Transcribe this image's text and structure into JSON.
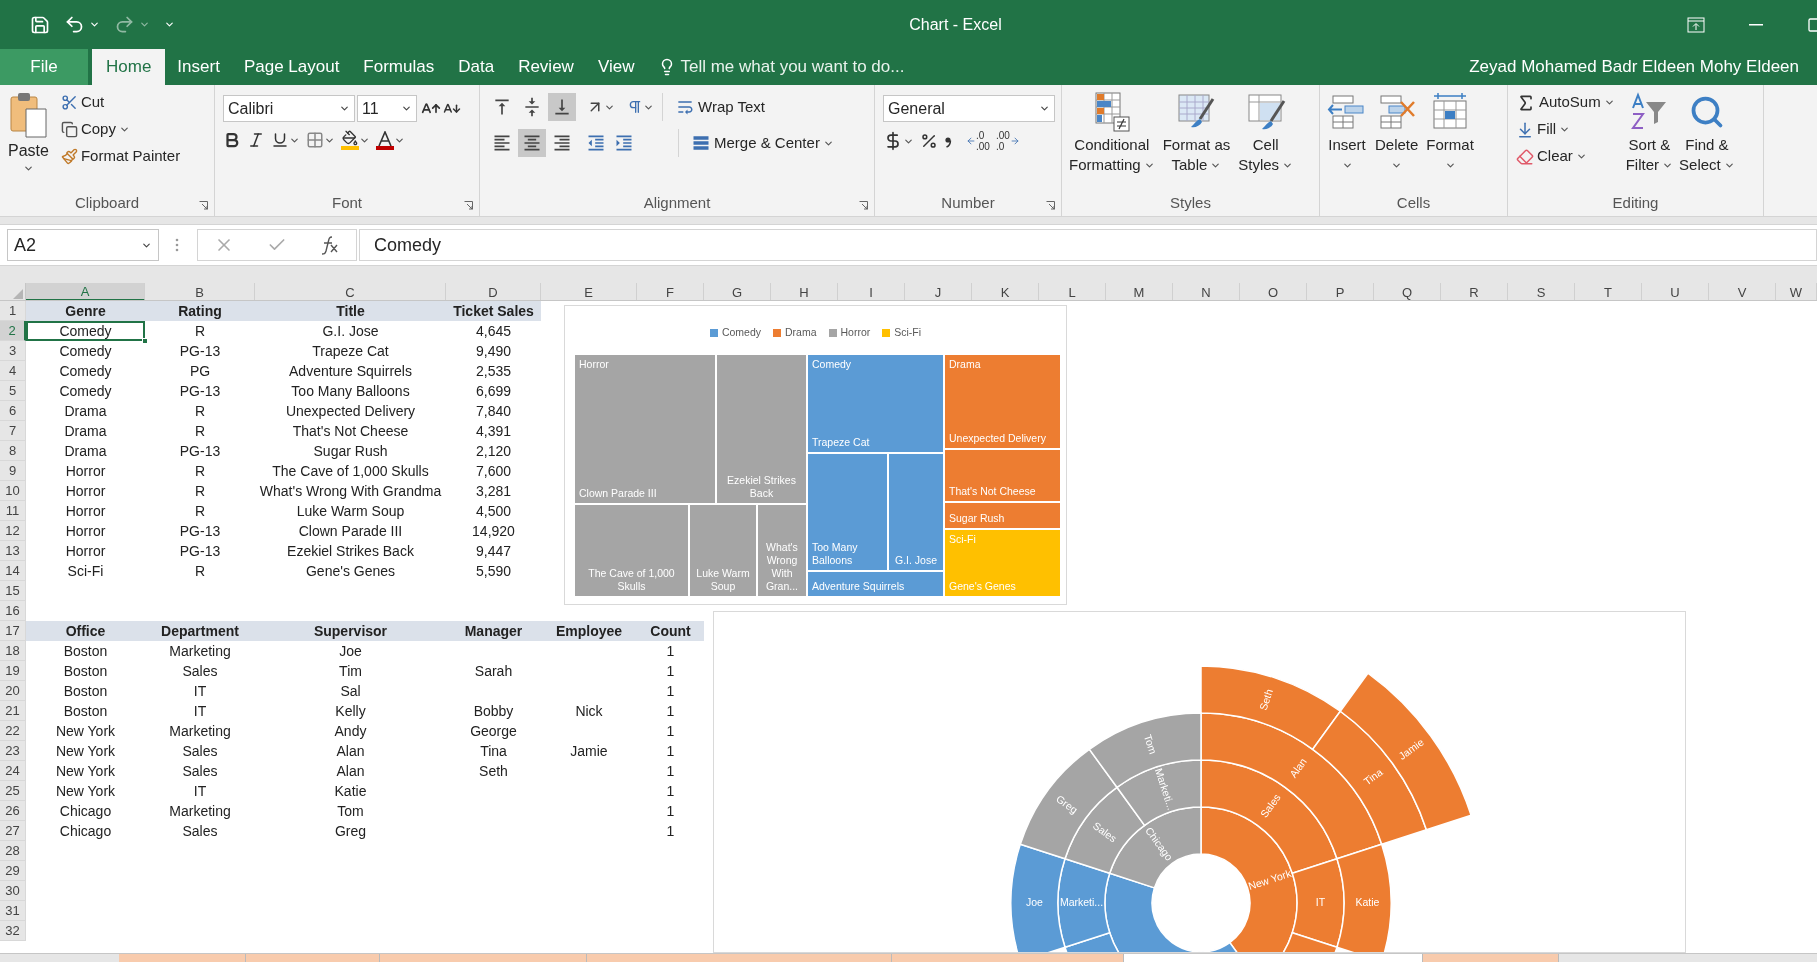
{
  "window": {
    "title": "Chart - Excel",
    "user": "Zeyad Mohamed Badr Eldeen Mohy Eldeen"
  },
  "ribbon_tabs": [
    {
      "label": "File",
      "kind": "file",
      "selected": false
    },
    {
      "label": "Home",
      "kind": "tab",
      "selected": true
    },
    {
      "label": "Insert",
      "kind": "tab",
      "selected": false
    },
    {
      "label": "Page Layout",
      "kind": "tab",
      "selected": false
    },
    {
      "label": "Formulas",
      "kind": "tab",
      "selected": false
    },
    {
      "label": "Data",
      "kind": "tab",
      "selected": false
    },
    {
      "label": "Review",
      "kind": "tab",
      "selected": false
    },
    {
      "label": "View",
      "kind": "tab",
      "selected": false
    }
  ],
  "tell_me": {
    "placeholder": "Tell me what you want to do..."
  },
  "clipboard": {
    "label": "Clipboard",
    "paste": "Paste",
    "cut": "Cut",
    "copy": "Copy",
    "format_painter": "Format Painter"
  },
  "font": {
    "label": "Font",
    "name": "Calibri",
    "size": "11"
  },
  "alignment": {
    "label": "Alignment",
    "wrap_text": "Wrap Text",
    "merge_center": "Merge & Center",
    "vertical": [
      {
        "selected": false
      },
      {
        "selected": false
      },
      {
        "selected": true
      }
    ],
    "horizontal": [
      {
        "selected": false
      },
      {
        "selected": true
      },
      {
        "selected": false
      }
    ]
  },
  "number": {
    "label": "Number",
    "format": "General",
    "increase_decimal": {
      "top": ".0",
      "bottom": ".00"
    },
    "decrease_decimal": {
      "top": ".00",
      "bottom": ".0"
    }
  },
  "styles": {
    "label": "Styles",
    "buttons": [
      {
        "kind": "conditional",
        "lines": [
          "Conditional",
          "Formatting"
        ]
      },
      {
        "kind": "table",
        "lines": [
          "Format as",
          "Table"
        ]
      },
      {
        "kind": "cell",
        "lines": [
          "Cell",
          "Styles"
        ]
      }
    ]
  },
  "cells": {
    "label": "Cells",
    "buttons": [
      {
        "kind": "insert",
        "label": "Insert"
      },
      {
        "kind": "delete",
        "label": "Delete"
      },
      {
        "kind": "format",
        "label": "Format"
      }
    ]
  },
  "editing": {
    "label": "Editing",
    "autosum": "AutoSum",
    "fill": "Fill",
    "clear": "Clear",
    "sort": [
      "Sort &",
      "Filter"
    ],
    "find": [
      "Find &",
      "Select"
    ]
  },
  "formula_bar": {
    "name_box": "A2",
    "formula": "Comedy"
  },
  "columns": [
    {
      "label": "A",
      "selected": true
    },
    {
      "label": "B",
      "selected": false
    },
    {
      "label": "C",
      "selected": false
    },
    {
      "label": "D",
      "selected": false
    },
    {
      "label": "E",
      "selected": false
    },
    {
      "label": "F",
      "selected": false
    },
    {
      "label": "G",
      "selected": false
    },
    {
      "label": "H",
      "selected": false
    },
    {
      "label": "I",
      "selected": false
    },
    {
      "label": "J",
      "selected": false
    },
    {
      "label": "K",
      "selected": false
    },
    {
      "label": "L",
      "selected": false
    },
    {
      "label": "M",
      "selected": false
    },
    {
      "label": "N",
      "selected": false
    },
    {
      "label": "O",
      "selected": false
    },
    {
      "label": "P",
      "selected": false
    },
    {
      "label": "Q",
      "selected": false
    },
    {
      "label": "R",
      "selected": false
    },
    {
      "label": "S",
      "selected": false
    },
    {
      "label": "T",
      "selected": false
    },
    {
      "label": "U",
      "selected": false
    },
    {
      "label": "V",
      "selected": false
    },
    {
      "label": "W",
      "selected": false
    }
  ],
  "row_headers": [
    {
      "label": "1",
      "selected": false
    },
    {
      "label": "2",
      "selected": true
    },
    {
      "label": "3",
      "selected": false
    },
    {
      "label": "4",
      "selected": false
    },
    {
      "label": "5",
      "selected": false
    },
    {
      "label": "6",
      "selected": false
    },
    {
      "label": "7",
      "selected": false
    },
    {
      "label": "8",
      "selected": false
    },
    {
      "label": "9",
      "selected": false
    },
    {
      "label": "10",
      "selected": false
    },
    {
      "label": "11",
      "selected": false
    },
    {
      "label": "12",
      "selected": false
    },
    {
      "label": "13",
      "selected": false
    },
    {
      "label": "14",
      "selected": false
    },
    {
      "label": "15",
      "selected": false
    },
    {
      "label": "16",
      "selected": false
    },
    {
      "label": "17",
      "selected": false
    },
    {
      "label": "18",
      "selected": false
    },
    {
      "label": "19",
      "selected": false
    },
    {
      "label": "20",
      "selected": false
    },
    {
      "label": "21",
      "selected": false
    },
    {
      "label": "22",
      "selected": false
    },
    {
      "label": "23",
      "selected": false
    },
    {
      "label": "24",
      "selected": false
    },
    {
      "label": "25",
      "selected": false
    },
    {
      "label": "26",
      "selected": false
    },
    {
      "label": "27",
      "selected": false
    },
    {
      "label": "28",
      "selected": false
    },
    {
      "label": "29",
      "selected": false
    },
    {
      "label": "30",
      "selected": false
    },
    {
      "label": "31",
      "selected": false
    },
    {
      "label": "32",
      "selected": false
    }
  ],
  "movies": {
    "header": [
      "Genre",
      "Rating",
      "Title",
      "Ticket Sales"
    ],
    "rows": [
      {
        "genre": "Comedy",
        "rating": "R",
        "title": "G.I. Jose",
        "sales": "4,645",
        "selected": true
      },
      {
        "genre": "Comedy",
        "rating": "PG-13",
        "title": "Trapeze Cat",
        "sales": "9,490",
        "selected": false
      },
      {
        "genre": "Comedy",
        "rating": "PG",
        "title": "Adventure Squirrels",
        "sales": "2,535",
        "selected": false
      },
      {
        "genre": "Comedy",
        "rating": "PG-13",
        "title": "Too Many Balloons",
        "sales": "6,699",
        "selected": false
      },
      {
        "genre": "Drama",
        "rating": "R",
        "title": "Unexpected Delivery",
        "sales": "7,840",
        "selected": false
      },
      {
        "genre": "Drama",
        "rating": "R",
        "title": "That's Not Cheese",
        "sales": "4,391",
        "selected": false
      },
      {
        "genre": "Drama",
        "rating": "PG-13",
        "title": "Sugar Rush",
        "sales": "2,120",
        "selected": false
      },
      {
        "genre": "Horror",
        "rating": "R",
        "title": "The Cave of 1,000 Skulls",
        "sales": "7,600",
        "selected": false
      },
      {
        "genre": "Horror",
        "rating": "R",
        "title": "What's Wrong With Grandma",
        "sales": "3,281",
        "selected": false
      },
      {
        "genre": "Horror",
        "rating": "R",
        "title": "Luke Warm Soup",
        "sales": "4,500",
        "selected": false
      },
      {
        "genre": "Horror",
        "rating": "PG-13",
        "title": "Clown Parade III",
        "sales": "14,920",
        "selected": false
      },
      {
        "genre": "Horror",
        "rating": "PG-13",
        "title": "Ezekiel Strikes Back",
        "sales": "9,447",
        "selected": false
      },
      {
        "genre": "Sci-Fi",
        "rating": "R",
        "title": "Gene's Genes",
        "sales": "5,590",
        "selected": false
      }
    ]
  },
  "staff": {
    "header": [
      "Office",
      "Department",
      "Supervisor",
      "Manager",
      "Employee",
      "Count"
    ],
    "rows": [
      {
        "office": "Boston",
        "department": "Marketing",
        "supervisor": "Joe",
        "count": "1"
      },
      {
        "office": "Boston",
        "department": "Sales",
        "supervisor": "Tim",
        "manager": "Sarah",
        "count": "1"
      },
      {
        "office": "Boston",
        "department": "IT",
        "supervisor": "Sal",
        "count": "1"
      },
      {
        "office": "Boston",
        "department": "IT",
        "supervisor": "Kelly",
        "manager": "Bobby",
        "employee": "Nick",
        "count": "1"
      },
      {
        "office": "New York",
        "department": "Marketing",
        "supervisor": "Andy",
        "manager": "George",
        "count": "1"
      },
      {
        "office": "New York",
        "department": "Sales",
        "supervisor": "Alan",
        "manager": "Tina",
        "employee": "Jamie",
        "count": "1"
      },
      {
        "office": "New York",
        "department": "Sales",
        "supervisor": "Alan",
        "manager": "Seth",
        "count": "1"
      },
      {
        "office": "New York",
        "department": "IT",
        "supervisor": "Katie",
        "count": "1"
      },
      {
        "office": "Chicago",
        "department": "Marketing",
        "supervisor": "Tom",
        "count": "1"
      },
      {
        "office": "Chicago",
        "department": "Sales",
        "supervisor": "Greg",
        "count": "1"
      }
    ]
  },
  "treemap": {
    "legend": [
      {
        "label": "Comedy",
        "color": "#5b9bd5"
      },
      {
        "label": "Drama",
        "color": "#ed7d31"
      },
      {
        "label": "Horror",
        "color": "#a5a5a5"
      },
      {
        "label": "Sci-Fi",
        "color": "#ffc000"
      }
    ],
    "groups": [
      {
        "label": "Horror",
        "color": "#a5a5a5",
        "tiles": [
          "Clown Parade III",
          "Ezekiel Strikes Back",
          "The Cave of 1,000 Skulls",
          "Luke Warm Soup",
          "What's Wrong With Gran..."
        ]
      },
      {
        "label": "Comedy",
        "color": "#5b9bd5",
        "tiles": [
          "Trapeze Cat",
          "Too Many Balloons",
          "G.I. Jose",
          "Adventure Squirrels"
        ]
      },
      {
        "label": "Drama",
        "color": "#ed7d31",
        "tiles": [
          "Unexpected Delivery",
          "That's Not Cheese",
          "Sugar Rush"
        ]
      },
      {
        "label": "Sci-Fi",
        "color": "#ffc000",
        "tiles": [
          "Gene's Genes"
        ]
      }
    ]
  },
  "sunburst": {
    "nodes": [
      {
        "kind": "arc",
        "label": "New York",
        "color": "#ed7d31",
        "children": [
          {
            "kind": "arc",
            "label": "Sales",
            "children": [
              {
                "kind": "arc",
                "label": "Alan",
                "children": [
                  {
                    "kind": "arc",
                    "label": "Seth"
                  },
                  {
                    "kind": "arc",
                    "label": "Tina",
                    "children": [
                      {
                        "kind": "arc",
                        "label": "Jamie"
                      }
                    ]
                  }
                ]
              }
            ]
          },
          {
            "kind": "arc",
            "label": "IT",
            "children": [
              {
                "kind": "arc",
                "label": "Katie"
              }
            ]
          },
          {
            "kind": "arc",
            "children": [
              {
                "kind": "arc",
                "children": [
                  {
                    "kind": "arc"
                  }
                ]
              }
            ]
          }
        ]
      },
      {
        "kind": "arc",
        "color": "#5b9bd5",
        "children": [
          {
            "kind": "arc",
            "children": [
              {
                "kind": "arc"
              },
              {
                "kind": "arc"
              }
            ]
          },
          {
            "kind": "arc",
            "children": [
              {
                "kind": "arc"
              }
            ]
          },
          {
            "kind": "arc",
            "label": "Marketi...",
            "children": [
              {
                "kind": "arc",
                "label": "Joe"
              }
            ]
          }
        ]
      },
      {
        "kind": "arc",
        "label": "Chicago",
        "color": "#a5a5a5",
        "children": [
          {
            "kind": "arc",
            "label": "Sales",
            "children": [
              {
                "kind": "arc",
                "label": "Greg"
              }
            ]
          },
          {
            "kind": "arc",
            "label": "Marketi...",
            "children": [
              {
                "kind": "arc",
                "label": "Tom"
              }
            ]
          }
        ]
      }
    ]
  },
  "sheet_tabs": [
    {
      "selected": false
    },
    {
      "selected": false
    },
    {
      "selected": false
    },
    {
      "selected": false
    },
    {
      "selected": false
    },
    {
      "selected": true
    },
    {
      "selected": false
    }
  ]
}
